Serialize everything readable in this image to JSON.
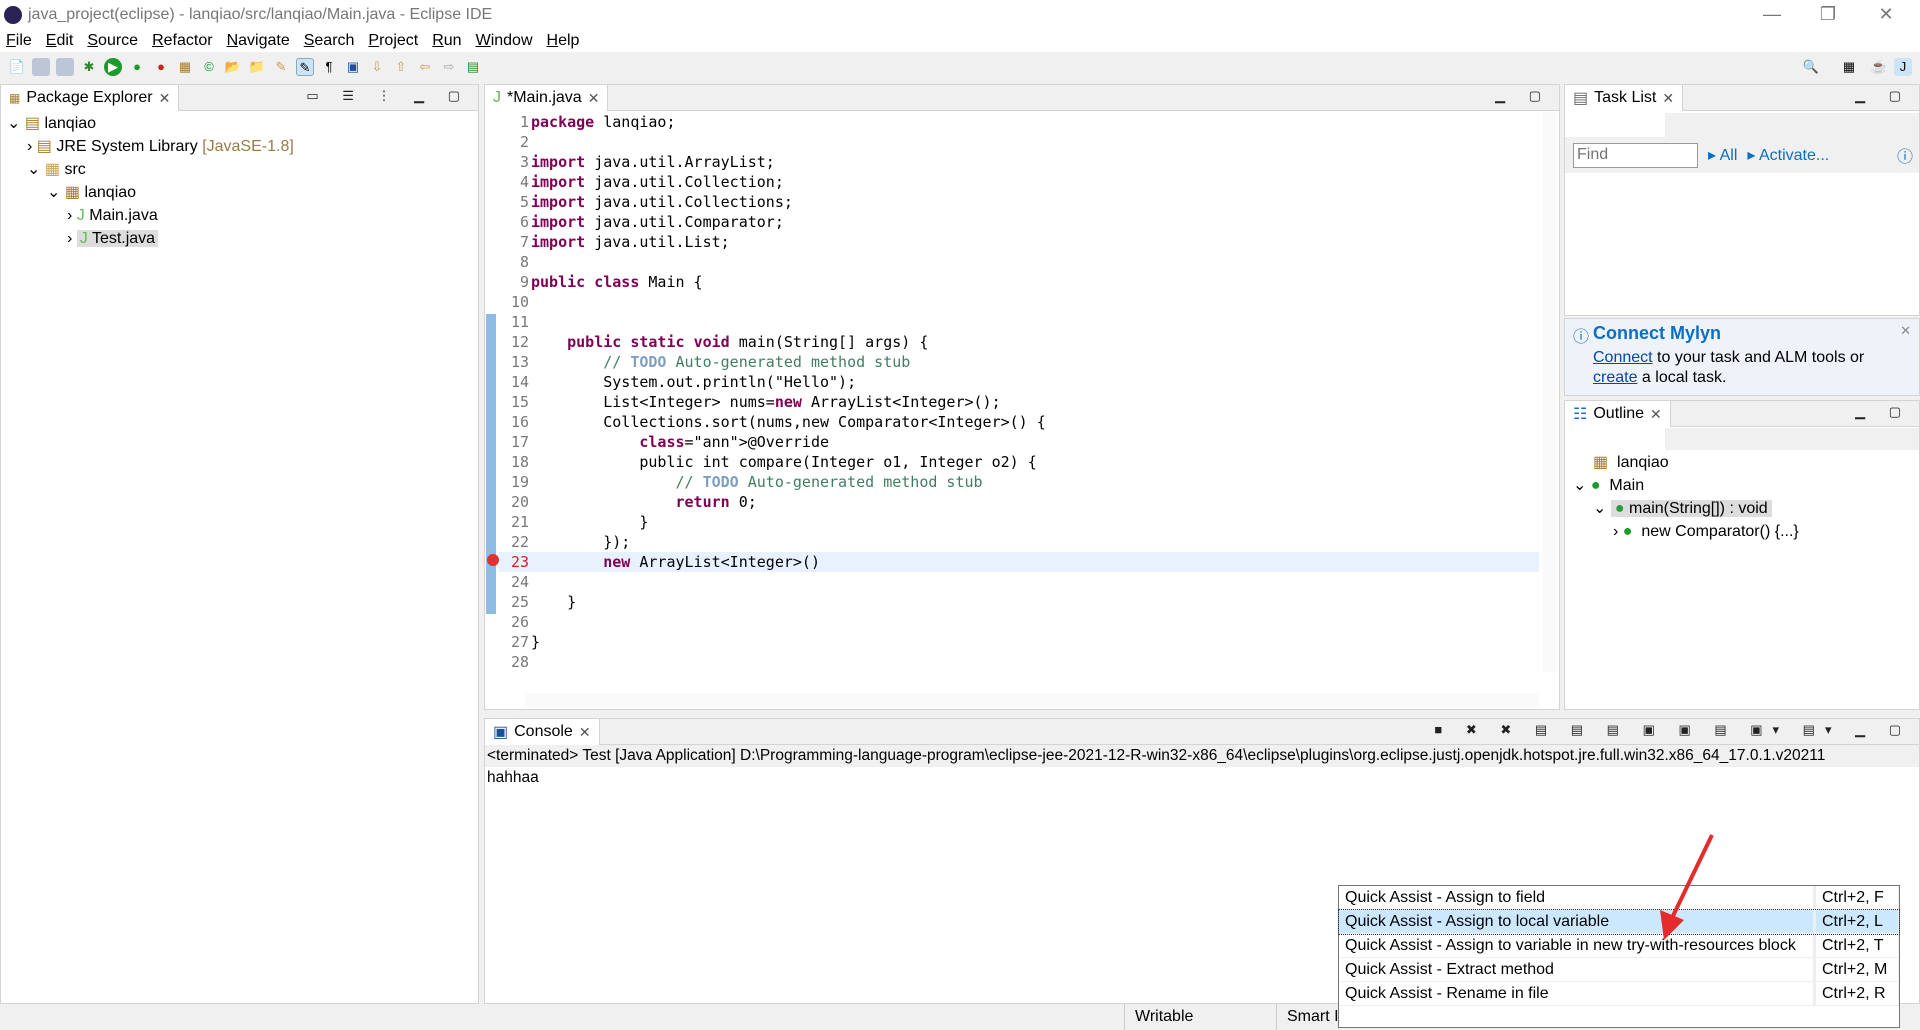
{
  "window": {
    "title": "java_project(eclipse) - lanqiao/src/lanqiao/Main.java - Eclipse IDE"
  },
  "menu": [
    "File",
    "Edit",
    "Source",
    "Refactor",
    "Navigate",
    "Search",
    "Project",
    "Run",
    "Window",
    "Help"
  ],
  "package_explorer": {
    "title": "Package Explorer",
    "items": [
      {
        "label": "lanqiao"
      },
      {
        "label": "JRE System Library",
        "extra": "[JavaSE-1.8]"
      },
      {
        "label": "src"
      },
      {
        "label": "lanqiao"
      },
      {
        "label": "Main.java"
      },
      {
        "label": "Test.java"
      }
    ]
  },
  "editor": {
    "tab": "*Main.java",
    "lines": [
      "package lanqiao;",
      "",
      "import java.util.ArrayList;",
      "import java.util.Collection;",
      "import java.util.Collections;",
      "import java.util.Comparator;",
      "import java.util.List;",
      "",
      "public class Main {",
      "",
      "",
      "    public static void main(String[] args) {",
      "        // TODO Auto-generated method stub",
      "        System.out.println(\"Hello\");",
      "        List<Integer> nums=new ArrayList<Integer>();",
      "        Collections.sort(nums,new Comparator<Integer>() {",
      "            @Override",
      "            public int compare(Integer o1, Integer o2) {",
      "                // TODO Auto-generated method stub",
      "                return 0;",
      "            }",
      "        });",
      "        new ArrayList<Integer>()",
      "",
      "    }",
      "",
      "}",
      ""
    ]
  },
  "task_list": {
    "title": "Task List",
    "find_placeholder": "Find",
    "all": "All",
    "activate": "Activate..."
  },
  "mylyn": {
    "title": "Connect Mylyn",
    "connect": "Connect",
    "text1": " to your task and ALM tools or",
    "create": "create",
    "text2": " a local task."
  },
  "outline": {
    "title": "Outline",
    "items": [
      "lanqiao",
      "Main",
      "main(String[]) : void",
      "new Comparator() {...}"
    ]
  },
  "console": {
    "title": "Console",
    "terminated": "<terminated> Test [Java Application] D:\\Programming-language-program\\eclipse-jee-2021-12-R-win32-x86_64\\eclipse\\plugins\\org.eclipse.justj.openjdk.hotspot.jre.full.win32.x86_64_17.0.1.v20211",
    "output": "hahhaa"
  },
  "quick_assist": [
    {
      "label": "Quick Assist - Assign to field",
      "shortcut": "Ctrl+2, F"
    },
    {
      "label": "Quick Assist - Assign to local variable",
      "shortcut": "Ctrl+2, L",
      "selected": true
    },
    {
      "label": "Quick Assist - Assign to variable in new try-with-resources block",
      "shortcut": "Ctrl+2, T"
    },
    {
      "label": "Quick Assist - Extract method",
      "shortcut": "Ctrl+2, M"
    },
    {
      "label": "Quick Assist - Rename in file",
      "shortcut": "Ctrl+2, R"
    }
  ],
  "status": {
    "writable": "Writable",
    "insert_mode": "Smart I"
  },
  "colors": {
    "accent": "#0b6fc4",
    "selection": "#cce8ff",
    "annotation_arrow": "#e52b2b"
  }
}
